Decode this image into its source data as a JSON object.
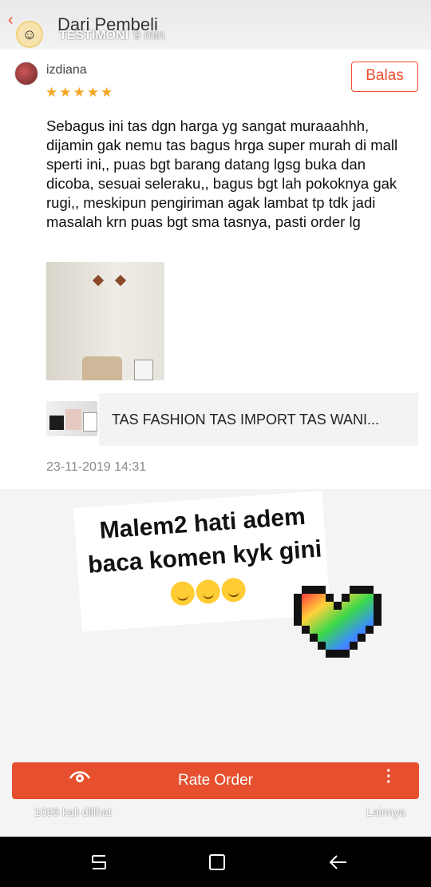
{
  "header": {
    "back_icon": "back-arrow-icon",
    "title": "Dari Pembeli",
    "story_account": "TESTIMONI",
    "story_time": "9 min"
  },
  "review": {
    "username": "izdiana",
    "rating": 5,
    "stars_text": "★★★★★",
    "reply_label": "Balas",
    "text": "Sebagus ini tas dgn harga yg sangat muraaahhh, dijamin gak nemu tas bagus hrga super murah di mall sperti ini,, puas bgt barang datang lgsg buka dan dicoba, sesuai seleraku,, bagus bgt lah pokoknya gak rugi,, meskipun pengiriman agak lambat tp tdk jadi masalah krn puas bgt sma tasnya, pasti order lg",
    "product_name": "TAS FASHION TAS IMPORT TAS WANI...",
    "date": "23-11-2019 14:31"
  },
  "sticker": {
    "text": "Malem2 hati adem baca komen kyk gini"
  },
  "footer": {
    "rate_label": "Rate Order",
    "views": "1096 kali dilihat",
    "more_label": "Lainnya"
  },
  "colors": {
    "accent": "#ee4d2d",
    "button": "#e6502e",
    "star": "#f5a623"
  }
}
